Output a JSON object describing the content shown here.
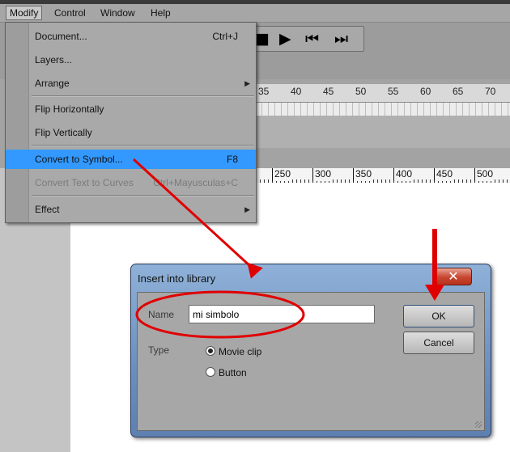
{
  "menubar": {
    "items": [
      "Modify",
      "Control",
      "Window",
      "Help"
    ]
  },
  "toolbar": {
    "transport_icons": [
      "stop-icon",
      "play-icon",
      "rewind-to-start-icon",
      "forward-to-end-icon"
    ]
  },
  "timeline": {
    "ruler_numbers": [
      "35",
      "40",
      "45",
      "50",
      "55",
      "60",
      "65",
      "70"
    ]
  },
  "stage_ruler": {
    "numbers": [
      "250",
      "300",
      "350",
      "400",
      "450",
      "500"
    ]
  },
  "modify_menu": {
    "items": [
      {
        "label": "Document...",
        "shortcut": "Ctrl+J",
        "submenu": false,
        "highlighted": false,
        "disabled": false
      },
      {
        "label": "Layers...",
        "shortcut": "",
        "submenu": false,
        "highlighted": false,
        "disabled": false
      },
      {
        "label": "Arrange",
        "shortcut": "",
        "submenu": true,
        "highlighted": false,
        "disabled": false
      },
      {
        "label": "Flip Horizontally",
        "shortcut": "",
        "submenu": false,
        "highlighted": false,
        "disabled": false
      },
      {
        "label": "Flip Vertically",
        "shortcut": "",
        "submenu": false,
        "highlighted": false,
        "disabled": false
      },
      {
        "label": "Convert to Symbol...",
        "shortcut": "F8",
        "submenu": false,
        "highlighted": true,
        "disabled": false
      },
      {
        "label": "Convert Text to Curves",
        "shortcut": "Ctrl+Mayusculas+C",
        "submenu": false,
        "highlighted": false,
        "disabled": true
      },
      {
        "label": "Effect",
        "shortcut": "",
        "submenu": true,
        "highlighted": false,
        "disabled": false
      }
    ]
  },
  "dialog": {
    "title": "Insert into library",
    "close_glyph": "✕",
    "name_label": "Name",
    "name_value": "mi simbolo",
    "type_label": "Type",
    "type_options": [
      "Movie clip",
      "Button"
    ],
    "type_selected": "Movie clip",
    "ok_label": "OK",
    "cancel_label": "Cancel"
  },
  "colors": {
    "menu_highlight": "#3399ff",
    "annotation_red": "#e00000",
    "dialog_title_gradient": "#6b8fbf",
    "close_button": "#c8452f"
  }
}
